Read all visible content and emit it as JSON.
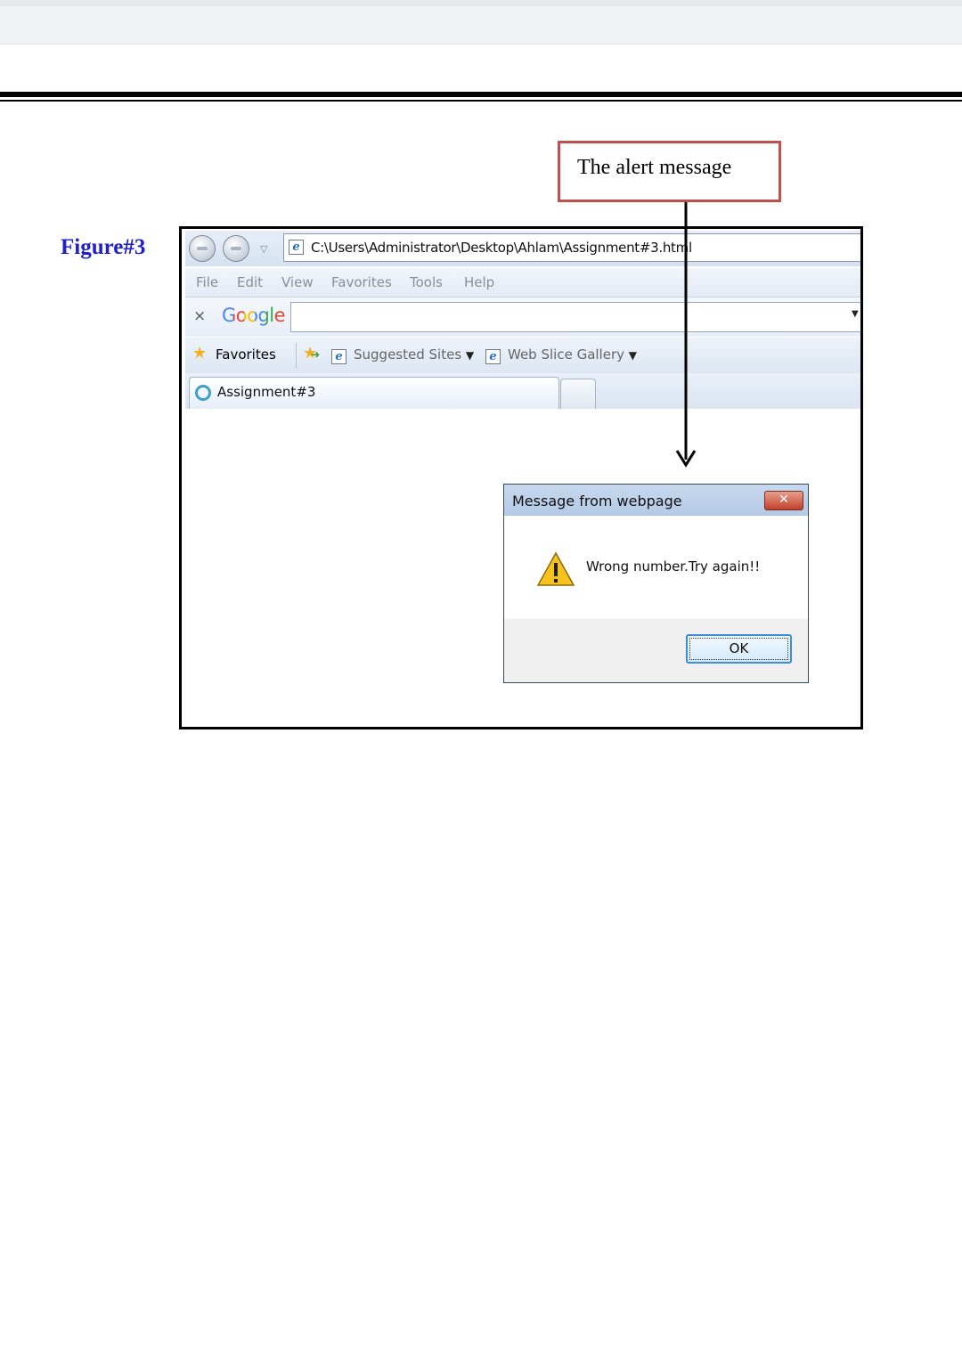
{
  "figure_label": "Figure#3",
  "callout": "The alert message",
  "browser": {
    "address": "C:\\Users\\Administrator\\Desktop\\Ahlam\\Assignment#3.html",
    "menu": [
      "File",
      "Edit",
      "View",
      "Favorites",
      "Tools",
      "Help"
    ],
    "google_logo": "Google",
    "favorites": {
      "label": "Favorites",
      "suggested_sites": "Suggested Sites",
      "web_slice_gallery": "Web Slice Gallery"
    },
    "tab_label": "Assignment#3"
  },
  "dialog": {
    "title": "Message from webpage",
    "message": "Wrong number.Try again!!",
    "ok_label": "OK"
  },
  "icons": [
    "back-icon",
    "forward-icon",
    "ie-page-icon",
    "star-icon",
    "add-favorite-icon",
    "loading-icon",
    "warning-icon",
    "close-icon"
  ]
}
